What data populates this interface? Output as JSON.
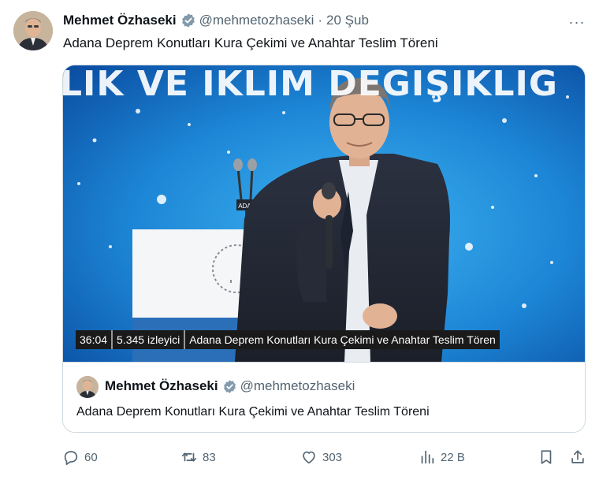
{
  "tweet": {
    "author_name": "Mehmet Özhaseki",
    "author_handle": "@mehmetozhaseki",
    "separator": "·",
    "date": "20 Şub",
    "more_label": "···",
    "text": "Adana Deprem Konutları Kura Çekimi ve Anahtar Teslim Töreni"
  },
  "video": {
    "banner_text": "LIK VE IKLIM DEGIŞIKLIG",
    "podium_sign": "ADANA",
    "duration": "36:04",
    "viewers": "5.345 izleyici",
    "title": "Adana Deprem Konutları Kura Çekimi ve Anahtar Teslim Tören"
  },
  "card": {
    "author_name": "Mehmet Özhaseki",
    "author_handle": "@mehmetozhaseki",
    "text": "Adana Deprem Konutları Kura Çekimi ve Anahtar Teslim Töreni"
  },
  "actions": {
    "replies": "60",
    "reposts": "83",
    "likes": "303",
    "views": "22 B"
  },
  "colors": {
    "text": "#0f1419",
    "secondary": "#536471",
    "border": "#cfd9de",
    "verified_badge": "#829aab"
  },
  "icons": [
    "verified-badge-icon",
    "more-icon",
    "reply-icon",
    "repost-icon",
    "like-icon",
    "views-icon",
    "bookmark-icon",
    "share-icon"
  ]
}
